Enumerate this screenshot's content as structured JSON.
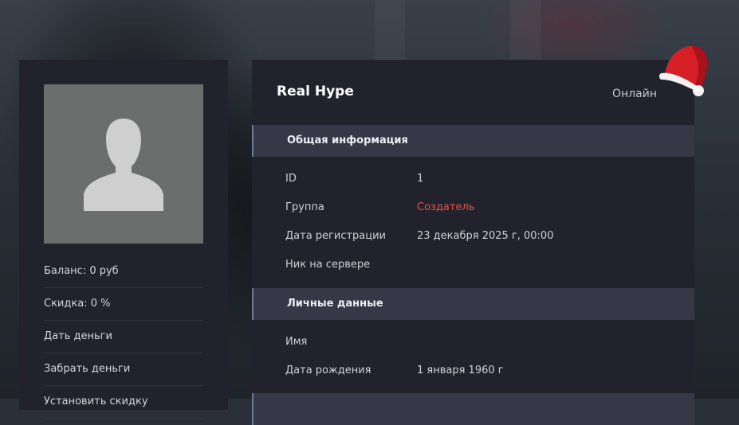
{
  "colors": {
    "card_bg": "#22222c",
    "section_bg": "#363848",
    "accent_red": "#e0564e",
    "avatar_bg": "#6b6e6d"
  },
  "sidebar": {
    "avatar_icon": "user-silhouette-icon",
    "items": [
      {
        "label": "Баланс: 0 руб"
      },
      {
        "label": "Скидка: 0 %"
      },
      {
        "label": "Дать деньги"
      },
      {
        "label": "Забрать деньги"
      },
      {
        "label": "Установить скидку"
      }
    ]
  },
  "profile": {
    "name": "Real Hype",
    "status": "Онлайн",
    "decoration_icon": "santa-hat-icon"
  },
  "sections": {
    "general": {
      "title": "Общая информация",
      "rows": [
        {
          "label": "ID",
          "value": "1"
        },
        {
          "label": "Группа",
          "value": "Создатель"
        },
        {
          "label": "Дата регистрации",
          "value": "23 декабря 2025 г, 00:00"
        },
        {
          "label": "Ник на сервере",
          "value": ""
        }
      ]
    },
    "personal": {
      "title": "Личные данные",
      "rows": [
        {
          "label": "Имя",
          "value": ""
        },
        {
          "label": "Дата рождения",
          "value": "1 января 1960 г"
        }
      ]
    }
  }
}
